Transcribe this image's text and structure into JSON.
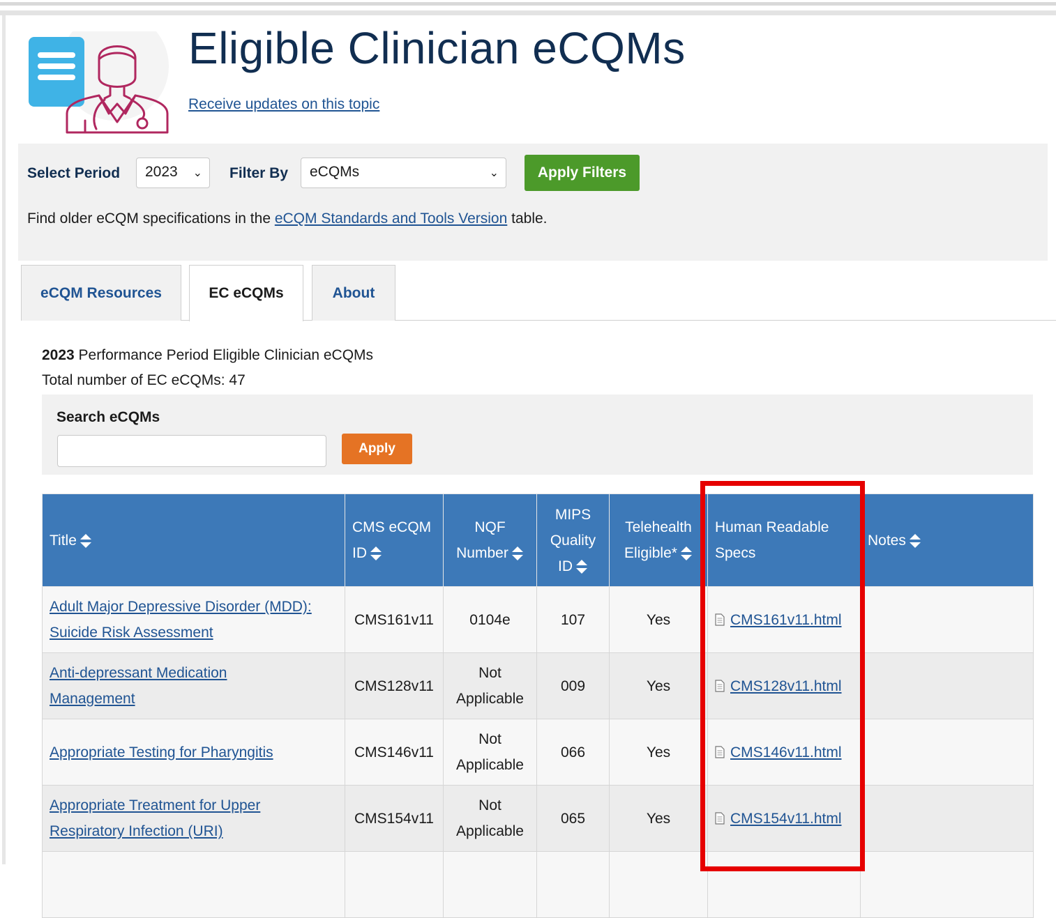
{
  "header": {
    "title": "Eligible Clinician eCQMs",
    "updates_link": "Receive updates on this topic",
    "icon": "clinician-document-icon"
  },
  "filters": {
    "period_label": "Select Period",
    "period_value": "2023",
    "filter_label": "Filter By",
    "filter_value": "eCQMs",
    "apply_label": "Apply Filters",
    "note_prefix": "Find older eCQM specifications in the ",
    "note_link": "eCQM Standards and Tools Version",
    "note_suffix": " table."
  },
  "tabs": [
    {
      "label": "eCQM Resources",
      "active": false
    },
    {
      "label": "EC eCQMs",
      "active": true
    },
    {
      "label": "About",
      "active": false
    }
  ],
  "summary": {
    "year": "2023",
    "period_text": " Performance Period Eligible Clinician eCQMs",
    "total_text": "Total number of EC eCQMs: 47"
  },
  "search": {
    "label": "Search eCQMs",
    "value": "",
    "apply_label": "Apply"
  },
  "table": {
    "headers": {
      "title": "Title",
      "cms_line1": "CMS eCQM",
      "cms_line2": "ID",
      "nqf_line1": "NQF",
      "nqf_line2": "Number",
      "mips_line1": "MIPS",
      "mips_line2": "Quality",
      "mips_line3": "ID",
      "tele_line1": "Telehealth",
      "tele_line2": "Eligible*",
      "spec_line1": "Human Readable",
      "spec_line2": "Specs",
      "notes": "Notes"
    },
    "rows": [
      {
        "title_line1": "Adult Major Depressive Disorder (MDD):",
        "title_line2": "Suicide Risk Assessment",
        "cms_id": "CMS161v11",
        "nqf_line1": "0104e",
        "nqf_line2": "",
        "mips_id": "107",
        "telehealth": "Yes",
        "spec": "CMS161v11.html",
        "notes": ""
      },
      {
        "title_line1": "Anti-depressant Medication",
        "title_line2": "Management",
        "cms_id": "CMS128v11",
        "nqf_line1": "Not",
        "nqf_line2": "Applicable",
        "mips_id": "009",
        "telehealth": "Yes",
        "spec": "CMS128v11.html",
        "notes": ""
      },
      {
        "title_line1": "Appropriate Testing for Pharyngitis",
        "title_line2": "",
        "cms_id": "CMS146v11",
        "nqf_line1": "Not",
        "nqf_line2": "Applicable",
        "mips_id": "066",
        "telehealth": "Yes",
        "spec": "CMS146v11.html",
        "notes": ""
      },
      {
        "title_line1": "Appropriate Treatment for Upper",
        "title_line2": "Respiratory Infection (URI)",
        "cms_id": "CMS154v11",
        "nqf_line1": "Not",
        "nqf_line2": "Applicable",
        "mips_id": "065",
        "telehealth": "Yes",
        "spec": "CMS154v11.html",
        "notes": ""
      }
    ]
  },
  "colors": {
    "title": "#112e51",
    "link": "#205493",
    "green_button": "#4c9a2a",
    "orange_button": "#e57324",
    "table_header": "#3d79b8",
    "highlight": "#e60000"
  }
}
